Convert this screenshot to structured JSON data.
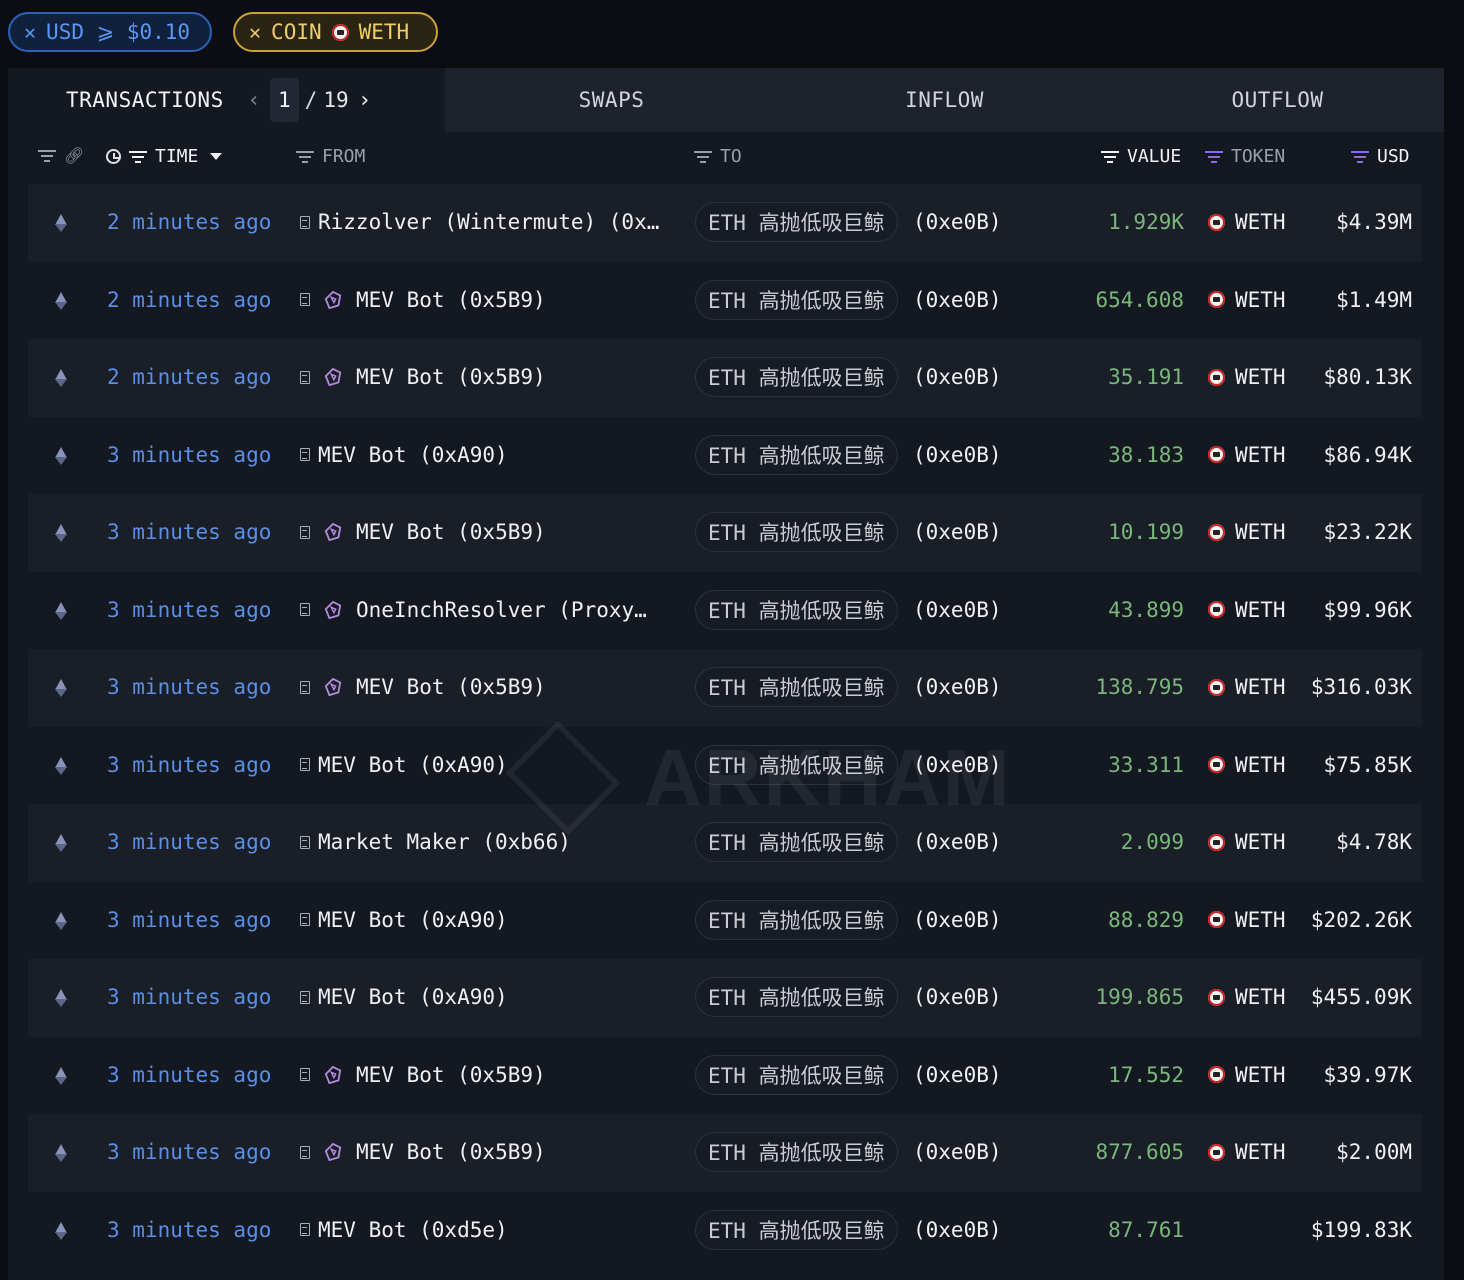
{
  "filters": {
    "usd": {
      "text": "USD ⩾ $0.10"
    },
    "coin": {
      "prefix": "COIN",
      "token": "WETH"
    }
  },
  "tabs": {
    "transactions": "TRANSACTIONS",
    "page_current": "1",
    "page_sep": "/",
    "page_total": "19",
    "swaps": "SWAPS",
    "inflow": "INFLOW",
    "outflow": "OUTFLOW"
  },
  "columns": {
    "time": "TIME",
    "from": "FROM",
    "to": "TO",
    "value": "VALUE",
    "token": "TOKEN",
    "usd": "USD"
  },
  "rows": [
    {
      "time": "2 minutes ago",
      "from": "Rizzolver (Wintermute) (0x…",
      "bot": false,
      "to_entity": "ETH 高抛低吸巨鲸",
      "to_addr": "(0xe0B)",
      "value": "1.929K",
      "token": "WETH",
      "usd": "$4.39M"
    },
    {
      "time": "2 minutes ago",
      "from": "MEV Bot (0x5B9)",
      "bot": true,
      "to_entity": "ETH 高抛低吸巨鲸",
      "to_addr": "(0xe0B)",
      "value": "654.608",
      "token": "WETH",
      "usd": "$1.49M"
    },
    {
      "time": "2 minutes ago",
      "from": "MEV Bot (0x5B9)",
      "bot": true,
      "to_entity": "ETH 高抛低吸巨鲸",
      "to_addr": "(0xe0B)",
      "value": "35.191",
      "token": "WETH",
      "usd": "$80.13K"
    },
    {
      "time": "3 minutes ago",
      "from": "MEV Bot (0xA90)",
      "bot": false,
      "to_entity": "ETH 高抛低吸巨鲸",
      "to_addr": "(0xe0B)",
      "value": "38.183",
      "token": "WETH",
      "usd": "$86.94K"
    },
    {
      "time": "3 minutes ago",
      "from": "MEV Bot (0x5B9)",
      "bot": true,
      "to_entity": "ETH 高抛低吸巨鲸",
      "to_addr": "(0xe0B)",
      "value": "10.199",
      "token": "WETH",
      "usd": "$23.22K"
    },
    {
      "time": "3 minutes ago",
      "from": "OneInchResolver (Proxy…",
      "bot": true,
      "to_entity": "ETH 高抛低吸巨鲸",
      "to_addr": "(0xe0B)",
      "value": "43.899",
      "token": "WETH",
      "usd": "$99.96K"
    },
    {
      "time": "3 minutes ago",
      "from": "MEV Bot (0x5B9)",
      "bot": true,
      "to_entity": "ETH 高抛低吸巨鲸",
      "to_addr": "(0xe0B)",
      "value": "138.795",
      "token": "WETH",
      "usd": "$316.03K"
    },
    {
      "time": "3 minutes ago",
      "from": "MEV Bot (0xA90)",
      "bot": false,
      "to_entity": "ETH 高抛低吸巨鲸",
      "to_addr": "(0xe0B)",
      "value": "33.311",
      "token": "WETH",
      "usd": "$75.85K"
    },
    {
      "time": "3 minutes ago",
      "from": "Market Maker (0xb66)",
      "bot": false,
      "to_entity": "ETH 高抛低吸巨鲸",
      "to_addr": "(0xe0B)",
      "value": "2.099",
      "token": "WETH",
      "usd": "$4.78K"
    },
    {
      "time": "3 minutes ago",
      "from": "MEV Bot (0xA90)",
      "bot": false,
      "to_entity": "ETH 高抛低吸巨鲸",
      "to_addr": "(0xe0B)",
      "value": "88.829",
      "token": "WETH",
      "usd": "$202.26K"
    },
    {
      "time": "3 minutes ago",
      "from": "MEV Bot (0xA90)",
      "bot": false,
      "to_entity": "ETH 高抛低吸巨鲸",
      "to_addr": "(0xe0B)",
      "value": "199.865",
      "token": "WETH",
      "usd": "$455.09K"
    },
    {
      "time": "3 minutes ago",
      "from": "MEV Bot (0x5B9)",
      "bot": true,
      "to_entity": "ETH 高抛低吸巨鲸",
      "to_addr": "(0xe0B)",
      "value": "17.552",
      "token": "WETH",
      "usd": "$39.97K"
    },
    {
      "time": "3 minutes ago",
      "from": "MEV Bot (0x5B9)",
      "bot": true,
      "to_entity": "ETH 高抛低吸巨鲸",
      "to_addr": "(0xe0B)",
      "value": "877.605",
      "token": "WETH",
      "usd": "$2.00M"
    },
    {
      "time": "3 minutes ago",
      "from": "MEV Bot (0xd5e)",
      "bot": false,
      "to_entity": "ETH 高抛低吸巨鲸",
      "to_addr": "(0xe0B)",
      "value": "87.761",
      "token": "",
      "usd": "$199.83K"
    }
  ],
  "watermark": "ARKHAM",
  "colors": {
    "time_link": "#5b8fe6",
    "value_green": "#7ab77c",
    "usd_chip_border": "#2c62b8",
    "coin_chip_border": "#c9a23a",
    "filter_active_purple": "#8b6ce8"
  }
}
